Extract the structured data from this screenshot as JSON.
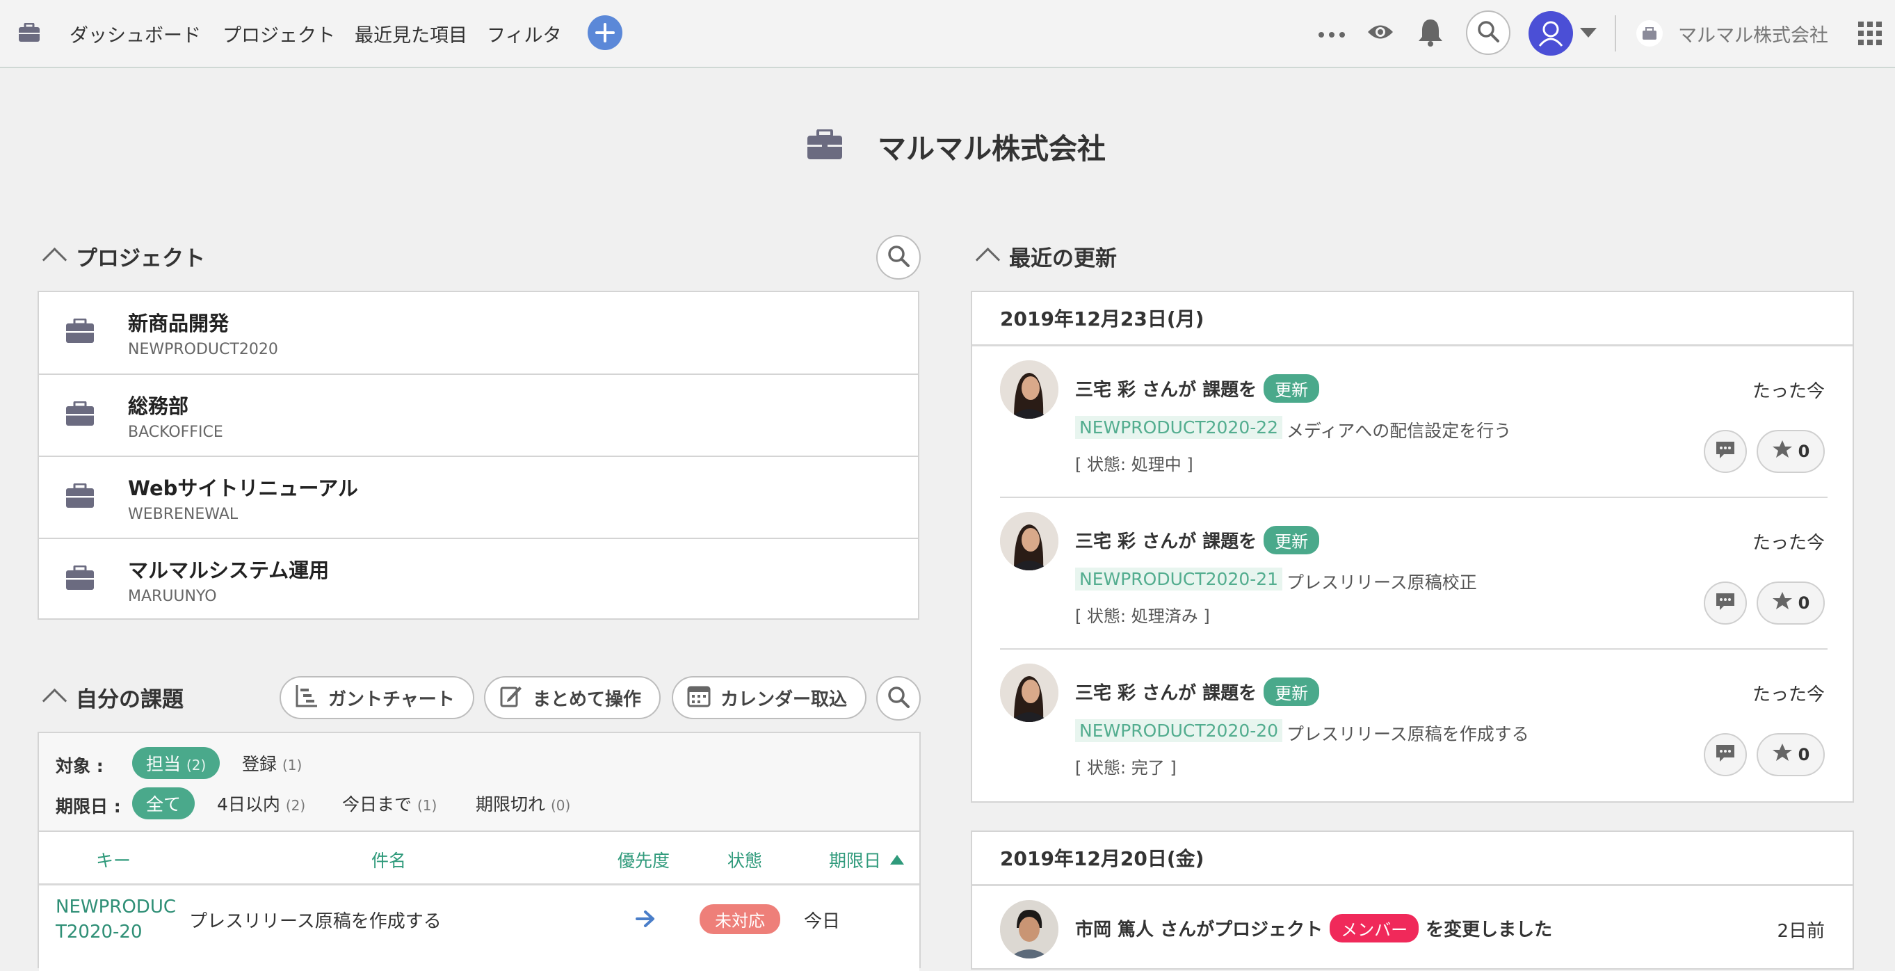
{
  "nav": {
    "dashboard": "ダッシュボード",
    "projects": "プロジェクト",
    "recent": "最近見た項目",
    "filter": "フィルタ",
    "space_name": "マルマル株式会社",
    "icons": [
      "briefcase-icon",
      "plus-icon",
      "more-icon",
      "eye-icon",
      "bell-icon",
      "search-icon",
      "user-icon",
      "apps-grid-icon"
    ]
  },
  "page": {
    "title": "マルマル株式会社"
  },
  "projects": {
    "heading": "プロジェクト",
    "items": [
      {
        "name": "新商品開発",
        "key": "NEWPRODUCT2020"
      },
      {
        "name": "総務部",
        "key": "BACKOFFICE"
      },
      {
        "name": "Webサイトリニューアル",
        "key": "WEBRENEWAL"
      },
      {
        "name": "マルマルシステム運用",
        "key": "MARUUNYO"
      }
    ]
  },
  "my_issues": {
    "heading": "自分の課題",
    "buttons": {
      "gantt": "ガントチャート",
      "bulk": "まとめて操作",
      "calendar": "カレンダー取込"
    },
    "target_label": "対象 :",
    "target": [
      {
        "label": "担当",
        "count": "(2)"
      },
      {
        "label": "登録",
        "count": "(1)"
      }
    ],
    "due_label": "期限日 :",
    "due": [
      {
        "label": "全て"
      },
      {
        "label": "4日以内",
        "count": "(2)"
      },
      {
        "label": "今日まで",
        "count": "(1)"
      },
      {
        "label": "期限切れ",
        "count": "(0)"
      }
    ],
    "columns": {
      "key": "キー",
      "subject": "件名",
      "priority": "優先度",
      "status": "状態",
      "due": "期限日"
    },
    "rows": [
      {
        "key_line1": "NEWPRODUC",
        "key_line2": "T2020-20",
        "subject": "プレスリリース原稿を作成する",
        "status": "未対応",
        "due": "今日"
      }
    ]
  },
  "updates": {
    "heading": "最近の更新",
    "days": [
      {
        "date": "2019年12月23日(月)",
        "items": [
          {
            "user": "三宅 彩",
            "action_pre": "さんが 課題を",
            "badge": "更新",
            "time": "たった今",
            "key": "NEWPRODUCT2020-22",
            "title": "メディアへの配信設定を行う",
            "status": "[ 状態: 処理中 ]",
            "stars": "0"
          },
          {
            "user": "三宅 彩",
            "action_pre": "さんが 課題を",
            "badge": "更新",
            "time": "たった今",
            "key": "NEWPRODUCT2020-21",
            "title": "プレスリリース原稿校正",
            "status": "[ 状態: 処理済み ]",
            "stars": "0"
          },
          {
            "user": "三宅 彩",
            "action_pre": "さんが 課題を",
            "badge": "更新",
            "time": "たった今",
            "key": "NEWPRODUCT2020-20",
            "title": "プレスリリース原稿を作成する",
            "status": "[ 状態: 完了 ]",
            "stars": "0"
          }
        ]
      },
      {
        "date": "2019年12月20日(金)",
        "items": [
          {
            "user": "市岡 篤人",
            "action_pre": "さんがプロジェクト",
            "badge": "メンバー",
            "action_post": "を変更しました",
            "time": "2日前"
          }
        ]
      }
    ]
  },
  "colors": {
    "accent": "#4aa98b",
    "link": "#2f8f76",
    "danger": "#f0295a",
    "status_open": "#ee7f79",
    "avatar_blue": "#4b4fd6"
  }
}
